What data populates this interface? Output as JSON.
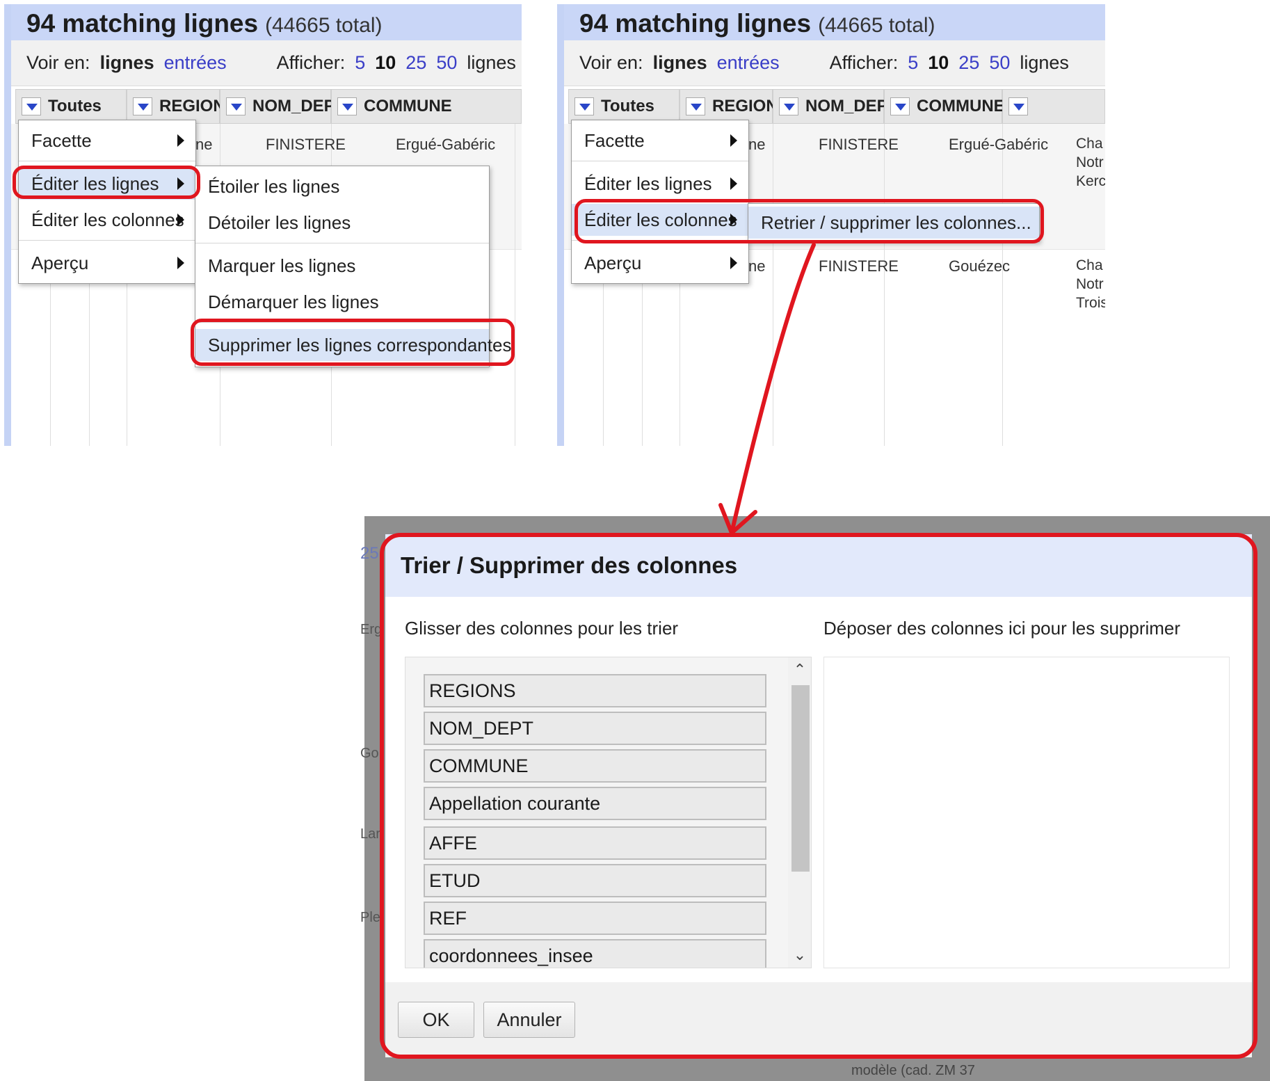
{
  "grid": {
    "title_count": "94 matching lignes",
    "title_total": "(44665 total)",
    "voir_label": "Voir en:",
    "voir_rows": "lignes",
    "voir_records": "entrées",
    "afficher_label": "Afficher:",
    "page_sizes": [
      "5",
      "10",
      "25",
      "50"
    ],
    "page_sizes_suffix": "lignes",
    "columns": [
      "Toutes",
      "REGIONS",
      "NOM_DEPT",
      "COMMUNE"
    ],
    "row1": {
      "region_partial": "ne",
      "dept": "FINISTERE",
      "commune": "Ergué-Gabéric",
      "extra": [
        "Cha",
        "Notr",
        "Kerc"
      ]
    },
    "row2": {
      "region_partial": "ne",
      "dept": "FINISTERE",
      "commune": "Gouézec",
      "extra": [
        "Cha",
        "Notr",
        "Trois"
      ]
    }
  },
  "all_menu": {
    "items": [
      "Facette",
      "Éditer les lignes",
      "Éditer les colonnes",
      "Aperçu"
    ]
  },
  "edit_rows_submenu": {
    "items": [
      "Étoiler les lignes",
      "Détoiler les lignes",
      "Marquer les lignes",
      "Démarquer les lignes",
      "Supprimer les lignes correspondantes"
    ]
  },
  "edit_columns_submenu": {
    "items": [
      "Retrier / supprimer les colonnes..."
    ]
  },
  "dialog": {
    "title": "Trier / Supprimer des colonnes",
    "reorder_label": "Glisser des colonnes pour les trier",
    "drop_label": "Déposer des colonnes ici pour les supprimer",
    "columns": [
      "REGIONS",
      "NOM_DEPT",
      "COMMUNE",
      "Appellation courante",
      "AFFE",
      "ETUD",
      "REF",
      "coordonnees_insee"
    ],
    "ok": "OK",
    "cancel": "Annuler",
    "background_fragments": [
      "25",
      "Erg",
      "Go",
      "Lar",
      "Ple",
      "modèle (cad. ZM 37"
    ]
  },
  "colors": {
    "header_blue": "#c9d6f7",
    "link_blue": "#3a3ec7",
    "menu_highlight": "#d9e4f7",
    "annotation_red": "#e0161f"
  }
}
